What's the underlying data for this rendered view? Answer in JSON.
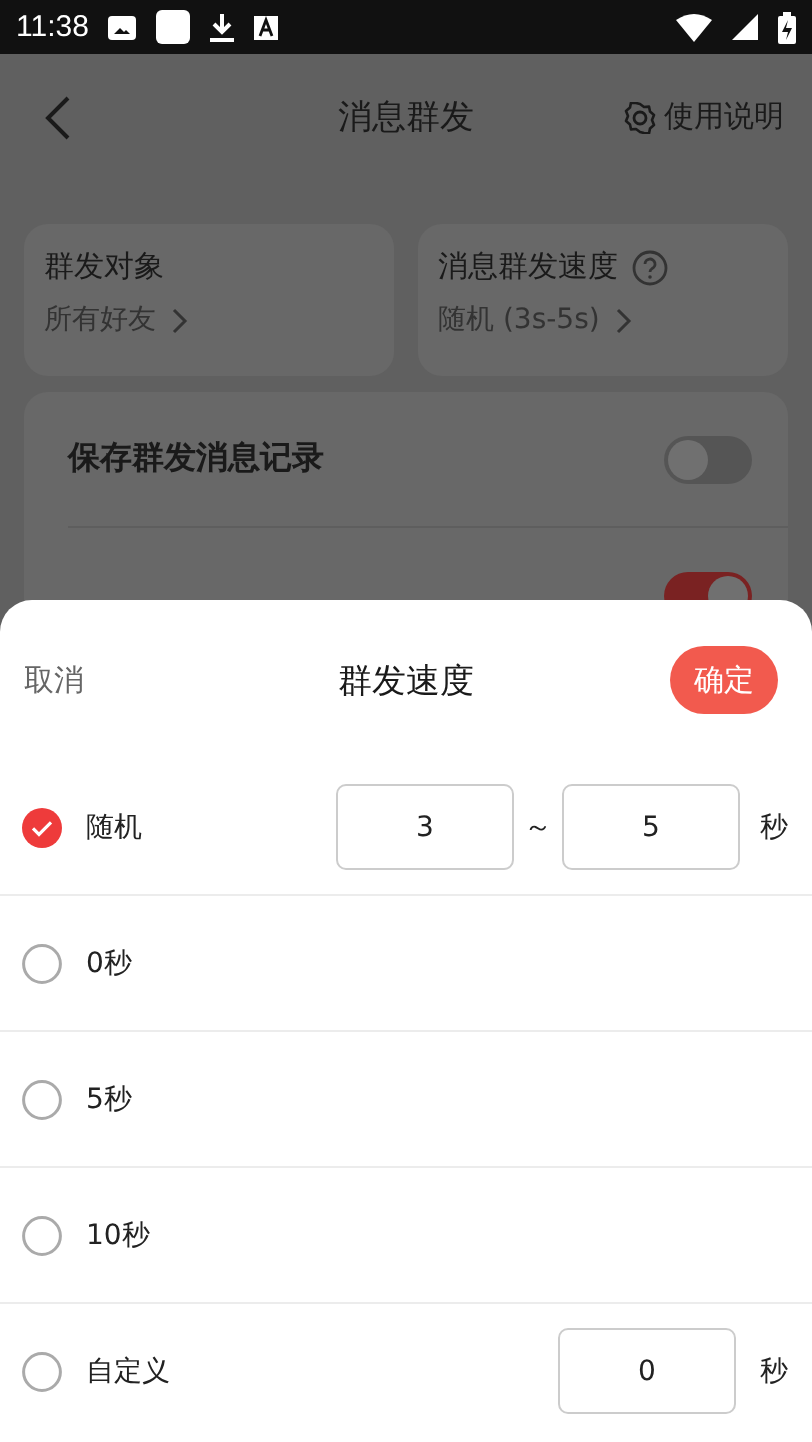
{
  "status_bar": {
    "time": "11:38"
  },
  "header": {
    "title": "消息群发",
    "help": "使用说明"
  },
  "cards": [
    {
      "title": "群发对象",
      "value": "所有好友",
      "help": false
    },
    {
      "title": "消息群发速度",
      "value": "随机 (3s-5s)",
      "help": true
    }
  ],
  "settings": [
    {
      "label": "保存群发消息记录",
      "on": false
    },
    {
      "on": true
    }
  ],
  "sheet": {
    "cancel": "取消",
    "title": "群发速度",
    "confirm": "确定",
    "options": [
      {
        "kind": "range",
        "label": "随机",
        "selected": true,
        "from": "3",
        "separator": "～",
        "to": "5",
        "unit": "秒"
      },
      {
        "kind": "plain",
        "label": "0秒",
        "selected": false
      },
      {
        "kind": "plain",
        "label": "5秒",
        "selected": false
      },
      {
        "kind": "plain",
        "label": "10秒",
        "selected": false
      },
      {
        "kind": "custom",
        "label": "自定义",
        "selected": false,
        "value": "0",
        "unit": "秒"
      }
    ]
  }
}
